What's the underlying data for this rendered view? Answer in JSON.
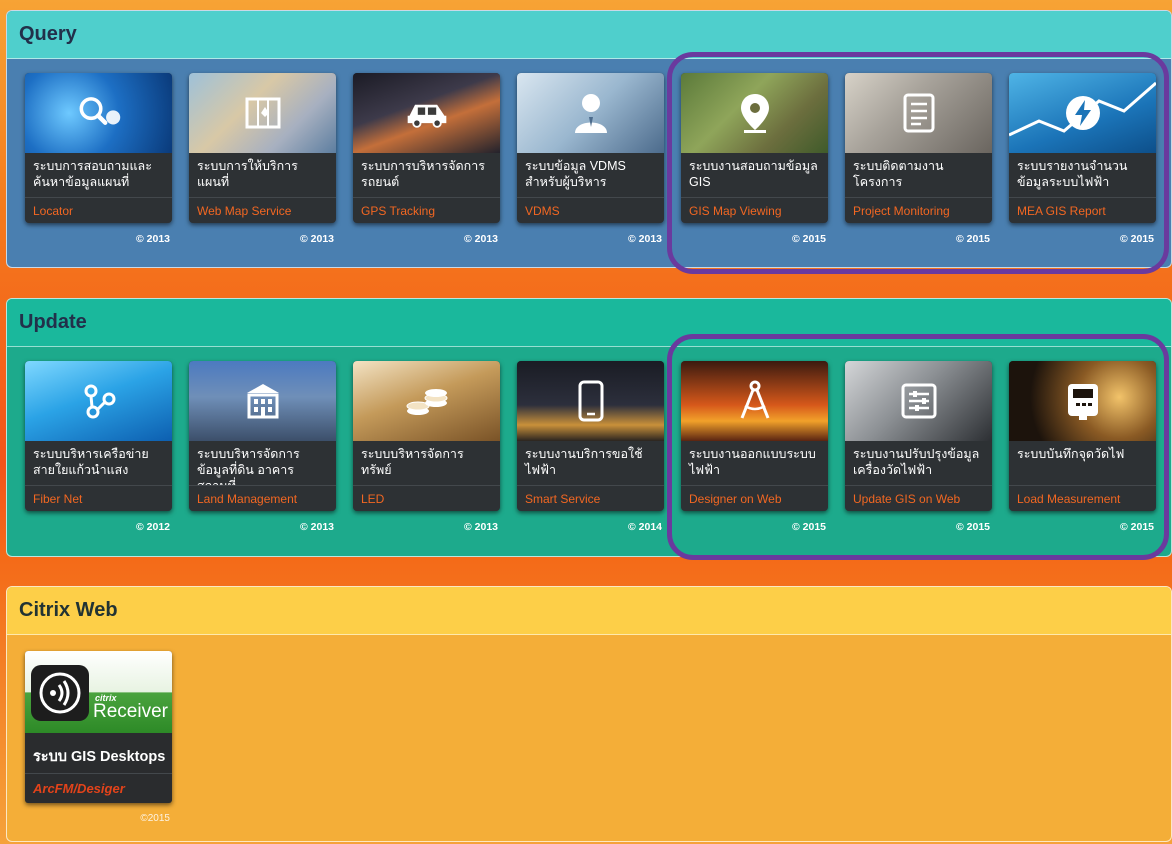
{
  "colors": {
    "highlight": "#6a3a9e",
    "subtitle_accent": "#f26722",
    "query_header": "#4fcfcc",
    "query_body": "#4a7fb0",
    "update_header": "#1ab89c",
    "update_body": "#1daa8c",
    "citrix_header": "#fdcf48",
    "citrix_body": "#f4ae38"
  },
  "sections": {
    "query": {
      "title": "Query",
      "tiles": [
        {
          "title": "ระบบการสอบถามและค้นหาข้อมูลแผนที่",
          "subtitle": "Locator",
          "year": "© 2013",
          "icon": "magnifier-icon"
        },
        {
          "title": "ระบบการให้บริการแผนที่",
          "subtitle": "Web Map Service",
          "year": "© 2013",
          "icon": "map-icon"
        },
        {
          "title": "ระบบการบริหารจัดการรถยนต์",
          "subtitle": "GPS Tracking",
          "year": "© 2013",
          "icon": "car-icon"
        },
        {
          "title": "ระบบข้อมูล VDMS สำหรับผู้บริหาร",
          "subtitle": "VDMS",
          "year": "© 2013",
          "icon": "user-icon"
        },
        {
          "title": "ระบบงานสอบถามข้อมูล GIS",
          "subtitle": "GIS Map Viewing",
          "year": "© 2015",
          "icon": "map-pin-icon"
        },
        {
          "title": "ระบบติดตามงานโครงการ",
          "subtitle": "Project Monitoring",
          "year": "© 2015",
          "icon": "document-icon"
        },
        {
          "title": "ระบบรายงานจำนวนข้อมูลระบบไฟฟ้า",
          "subtitle": "MEA GIS Report",
          "year": "© 2015",
          "icon": "lightning-icon"
        }
      ]
    },
    "update": {
      "title": "Update",
      "tiles": [
        {
          "title": "ระบบบริหารเครือข่ายสายใยแก้วนำแสง",
          "subtitle": "Fiber Net",
          "year": "© 2012",
          "icon": "network-icon"
        },
        {
          "title": "ระบบบริหารจัดการข้อมูลที่ดิน อาคาร สถานที่",
          "subtitle": "Land Management",
          "year": "© 2013",
          "icon": "building-icon"
        },
        {
          "title": "ระบบบริหารจัดการทรัพย์",
          "subtitle": "LED",
          "year": "© 2013",
          "icon": "coins-icon"
        },
        {
          "title": "ระบบงานบริการขอใช้ไฟฟ้า",
          "subtitle": "Smart Service",
          "year": "© 2014",
          "icon": "smartphone-icon"
        },
        {
          "title": "ระบบงานออกแบบระบบไฟฟ้า",
          "subtitle": "Designer on Web",
          "year": "© 2015",
          "icon": "compass-icon"
        },
        {
          "title": "ระบบงานปรับปรุงข้อมูลเครื่องวัดไฟฟ้า",
          "subtitle": "Update GIS on Web",
          "year": "© 2015",
          "icon": "sliders-icon"
        },
        {
          "title": "ระบบบันทึกจุดวัดไฟ",
          "subtitle": "Load Measurement",
          "year": "© 2015",
          "icon": "meter-icon"
        }
      ]
    },
    "citrix": {
      "title": "Citrix Web",
      "tile": {
        "brand": "citrix",
        "receiver": "Receiver",
        "title": "ระบบ GIS Desktops",
        "subtitle": "ArcFM/Desiger",
        "year": "©2015",
        "icon": "citrix-receiver-icon"
      }
    }
  }
}
